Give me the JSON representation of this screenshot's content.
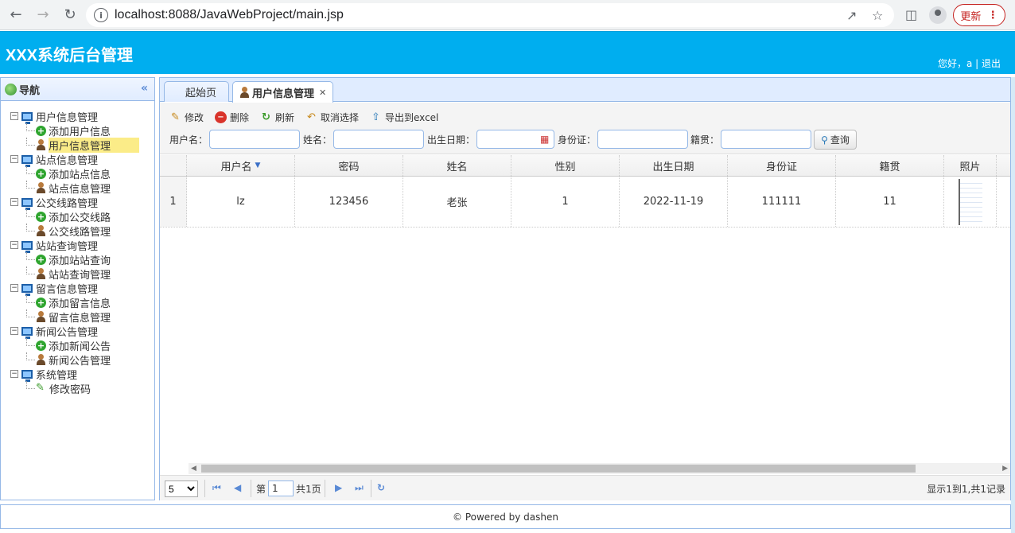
{
  "browser": {
    "url": "localhost:8088/JavaWebProject/main.jsp",
    "update_label": "更新"
  },
  "header": {
    "title": "XXX系统后台管理",
    "welcome": "您好，a | 退出"
  },
  "sidebar": {
    "title": "导航",
    "groups": [
      {
        "label": "用户信息管理",
        "children": [
          "添加用户信息",
          "用户信息管理"
        ]
      },
      {
        "label": "站点信息管理",
        "children": [
          "添加站点信息",
          "站点信息管理"
        ]
      },
      {
        "label": "公交线路管理",
        "children": [
          "添加公交线路",
          "公交线路管理"
        ]
      },
      {
        "label": "站站查询管理",
        "children": [
          "添加站站查询",
          "站站查询管理"
        ]
      },
      {
        "label": "留言信息管理",
        "children": [
          "添加留言信息",
          "留言信息管理"
        ]
      },
      {
        "label": "新闻公告管理",
        "children": [
          "添加新闻公告",
          "新闻公告管理"
        ]
      },
      {
        "label": "系统管理",
        "children": [
          "修改密码"
        ]
      }
    ]
  },
  "tabs": [
    {
      "label": "起始页"
    },
    {
      "label": "用户信息管理"
    }
  ],
  "toolbar": {
    "edit": "修改",
    "delete": "删除",
    "refresh": "刷新",
    "unselect": "取消选择",
    "export": "导出到excel"
  },
  "search": {
    "username_label": "用户名：",
    "name_label": "姓名：",
    "birth_label": "出生日期：",
    "idcard_label": "身份证：",
    "native_label": "籍贯：",
    "query_label": "查询"
  },
  "grid": {
    "columns": [
      "用户名",
      "密码",
      "姓名",
      "性别",
      "出生日期",
      "身份证",
      "籍贯",
      "照片"
    ],
    "rows": [
      {
        "num": "1",
        "cells": [
          "lz",
          "123456",
          "老张",
          "1",
          "2022-11-19",
          "111111",
          "11"
        ]
      }
    ]
  },
  "pager": {
    "page_size": "5",
    "page_prefix": "第",
    "page_value": "1",
    "page_suffix": "共1页",
    "info": "显示1到1,共1记录"
  },
  "footer": {
    "text": "© Powered by dashen"
  }
}
